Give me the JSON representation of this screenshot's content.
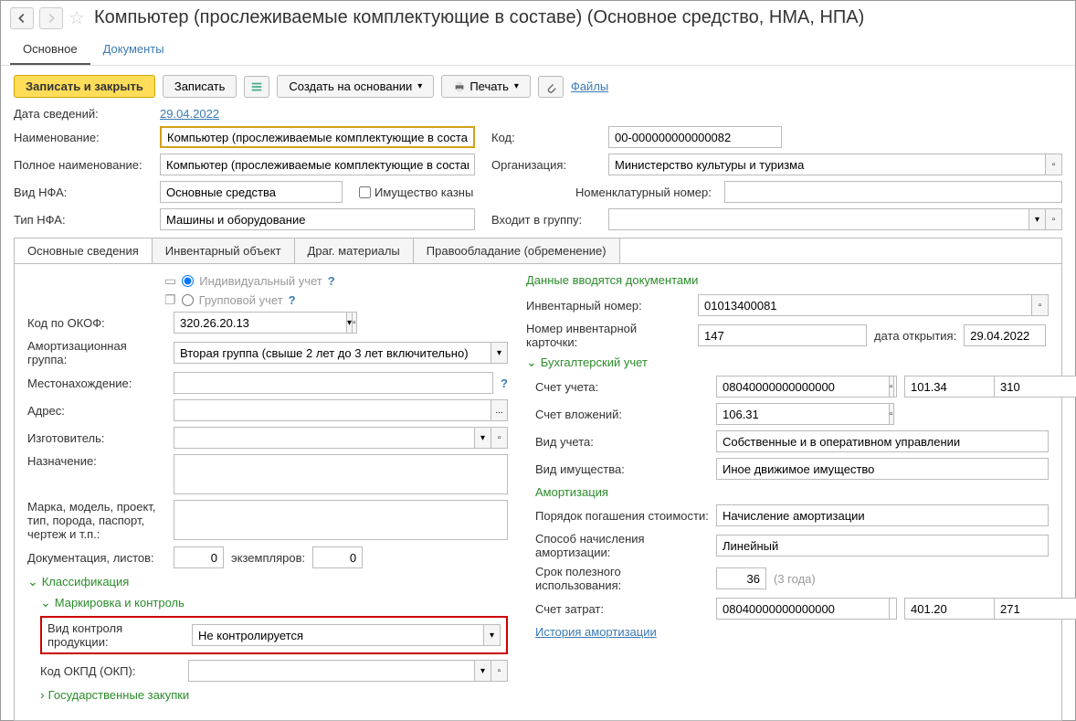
{
  "title": "Компьютер (прослеживаемые комплектующие в составе) (Основное средство, НМА, НПА)",
  "nav": {
    "main": "Основное",
    "docs": "Документы"
  },
  "toolbar": {
    "save_close": "Записать и закрыть",
    "save": "Записать",
    "create_based": "Создать на основании",
    "print": "Печать",
    "files": "Файлы"
  },
  "labels": {
    "date": "Дата сведений:",
    "name": "Наименование:",
    "full_name": "Полное наименование:",
    "vid_nfa": "Вид НФА:",
    "tip_nfa": "Тип НФА:",
    "kod": "Код:",
    "org": "Организация:",
    "nomen": "Номенклатурный номер:",
    "group": "Входит в группу:",
    "treasury": "Имущество казны"
  },
  "values": {
    "date": "29.04.2022",
    "name": "Компьютер (прослеживаемые комплектующие в составе)",
    "full_name": "Компьютер (прослеживаемые комплектующие в составе)",
    "vid_nfa": "Основные средства",
    "tip_nfa": "Машины и оборудование",
    "kod": "00-000000000000082",
    "org": "Министерство культуры и туризма"
  },
  "tabs": {
    "t1": "Основные сведения",
    "t2": "Инвентарный объект",
    "t3": "Драг. материалы",
    "t4": "Правообладание (обременение)"
  },
  "left": {
    "indiv": "Индивидуальный учет",
    "group": "Групповой учет",
    "okof_lbl": "Код по ОКОФ:",
    "okof": "320.26.20.13",
    "amort_grp_lbl": "Амортизационная группа:",
    "amort_grp": "Вторая группа (свыше 2 лет до 3 лет включительно)",
    "location_lbl": "Местонахождение:",
    "address_lbl": "Адрес:",
    "manufacturer_lbl": "Изготовитель:",
    "purpose_lbl": "Назначение:",
    "model_lbl": "Марка, модель, проект, тип, порода, паспорт, чертеж и т.п.:",
    "doc_lbl": "Документация, листов:",
    "doc_val": "0",
    "copies_lbl": "экземпляров:",
    "copies_val": "0",
    "classif": "Классификация",
    "marking": "Маркировка и контроль",
    "control_lbl": "Вид контроля продукции:",
    "control_val": "Не контролируется",
    "okpd_lbl": "Код ОКПД (ОКП):",
    "gos_zakup": "Государственные закупки"
  },
  "right": {
    "doc_data": "Данные вводятся документами",
    "inv_num_lbl": "Инвентарный номер:",
    "inv_num": "01013400081",
    "card_num_lbl": "Номер инвентарной карточки:",
    "card_num": "147",
    "open_date_lbl": "дата открытия:",
    "open_date": "29.04.2022",
    "buh": "Бухгалтерский учет",
    "acct_lbl": "Счет учета:",
    "acct": "08040000000000000",
    "acct_q": "1",
    "acct_sub": "101.34",
    "acct_sub2": "310",
    "invest_lbl": "Счет вложений:",
    "invest": "106.31",
    "vid_ucheta_lbl": "Вид учета:",
    "vid_ucheta": "Собственные и в оперативном управлении",
    "vid_imu_lbl": "Вид имущества:",
    "vid_imu": "Иное движимое имущество",
    "amort": "Амортизация",
    "pogash_lbl": "Порядок погашения стоимости:",
    "pogash": "Начисление амортизации",
    "sposob_lbl": "Способ начисления амортизации:",
    "sposob": "Линейный",
    "srok_lbl": "Срок полезного использования:",
    "srok": "36",
    "srok_note": "(3 года)",
    "zatrat_lbl": "Счет затрат:",
    "zatrat": "08040000000000000",
    "zatrat_q": "1",
    "zatrat_sub": "401.20",
    "zatrat_sub2": "271",
    "history": "История амортизации"
  }
}
